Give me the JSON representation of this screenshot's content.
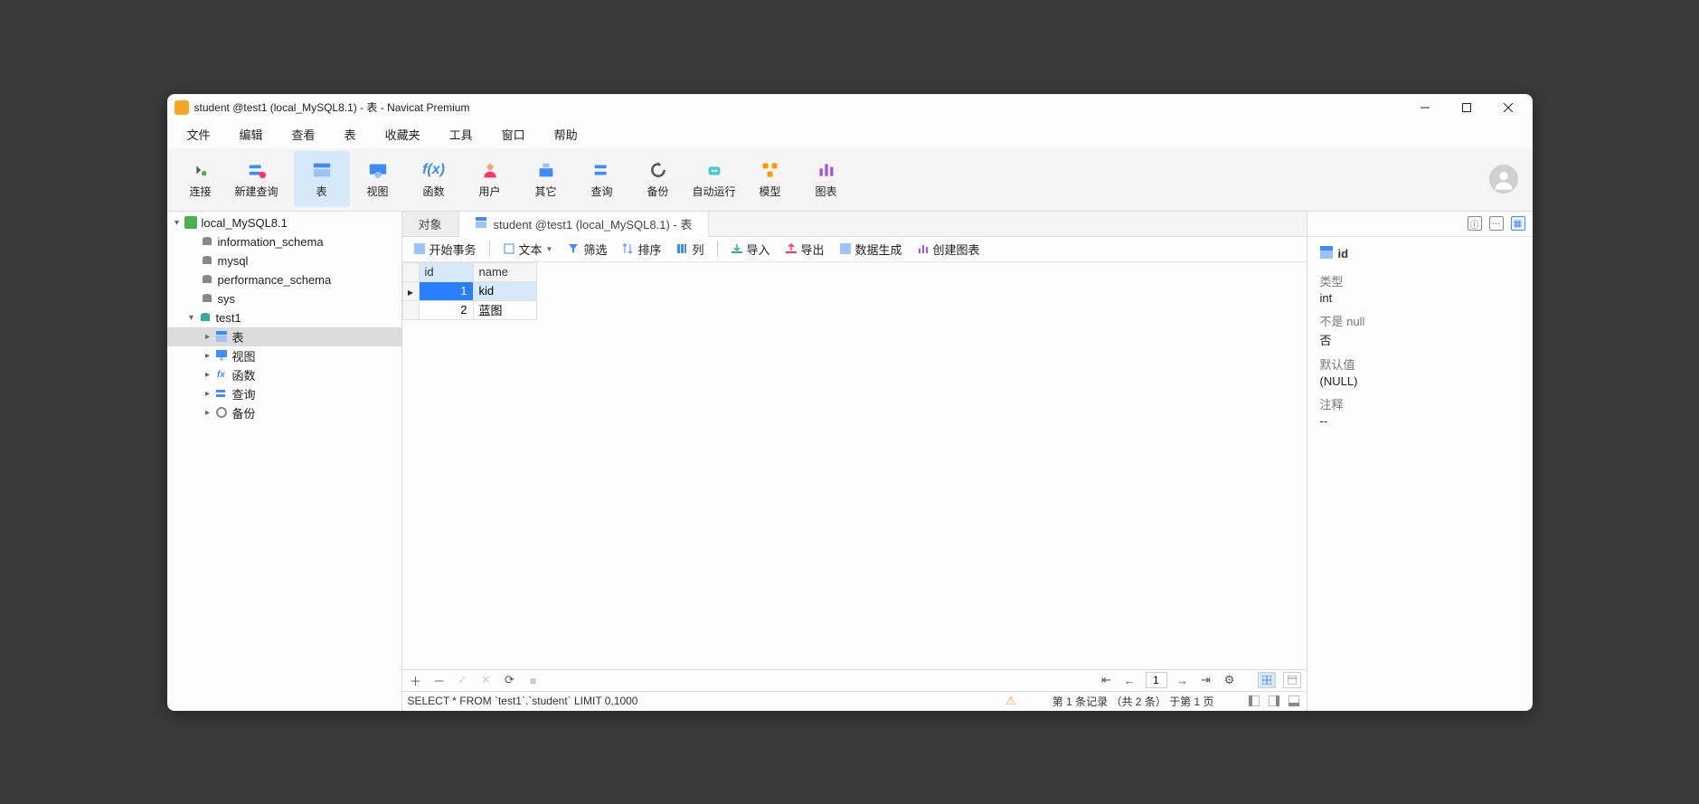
{
  "window": {
    "title": "student @test1 (local_MySQL8.1) - 表 - Navicat Premium"
  },
  "menubar": [
    "文件",
    "编辑",
    "查看",
    "表",
    "收藏夹",
    "工具",
    "窗口",
    "帮助"
  ],
  "toolbar": [
    {
      "id": "connect",
      "label": "连接"
    },
    {
      "id": "newquery",
      "label": "新建查询"
    },
    {
      "id": "table",
      "label": "表",
      "active": true
    },
    {
      "id": "view",
      "label": "视图"
    },
    {
      "id": "func",
      "label": "函数"
    },
    {
      "id": "user",
      "label": "用户"
    },
    {
      "id": "other",
      "label": "其它"
    },
    {
      "id": "query",
      "label": "查询"
    },
    {
      "id": "backup",
      "label": "备份"
    },
    {
      "id": "auto",
      "label": "自动运行"
    },
    {
      "id": "model",
      "label": "模型"
    },
    {
      "id": "chart",
      "label": "图表"
    }
  ],
  "tree": {
    "connection": "local_MySQL8.1",
    "databases": [
      "information_schema",
      "mysql",
      "performance_schema",
      "sys"
    ],
    "open_db": "test1",
    "folders": [
      {
        "label": "表",
        "selected": true
      },
      {
        "label": "视图"
      },
      {
        "label": "函数"
      },
      {
        "label": "查询"
      },
      {
        "label": "备份"
      }
    ]
  },
  "tabs": {
    "objects": "对象",
    "active": "student @test1 (local_MySQL8.1) - 表"
  },
  "subtoolbar": {
    "begin_tx": "开始事务",
    "text": "文本",
    "filter": "筛选",
    "sort": "排序",
    "columns": "列",
    "import": "导入",
    "export": "导出",
    "datagen": "数据生成",
    "createchart": "创建图表"
  },
  "grid": {
    "columns": [
      "id",
      "name"
    ],
    "rows": [
      {
        "id": "1",
        "name": "kid",
        "selected": true
      },
      {
        "id": "2",
        "name": "蓝图"
      }
    ]
  },
  "gridnav": {
    "page": "1"
  },
  "footer": {
    "sql": "SELECT * FROM `test1`.`student` LIMIT 0,1000",
    "status": "第 1 条记录 （共 2 条） 于第 1 页"
  },
  "inspector": {
    "field_name": "id",
    "props": [
      {
        "label": "类型",
        "value": "int"
      },
      {
        "label": "不是 null",
        "value": "否"
      },
      {
        "label": "默认值",
        "value": "(NULL)"
      },
      {
        "label": "注释",
        "value": "--"
      }
    ]
  }
}
